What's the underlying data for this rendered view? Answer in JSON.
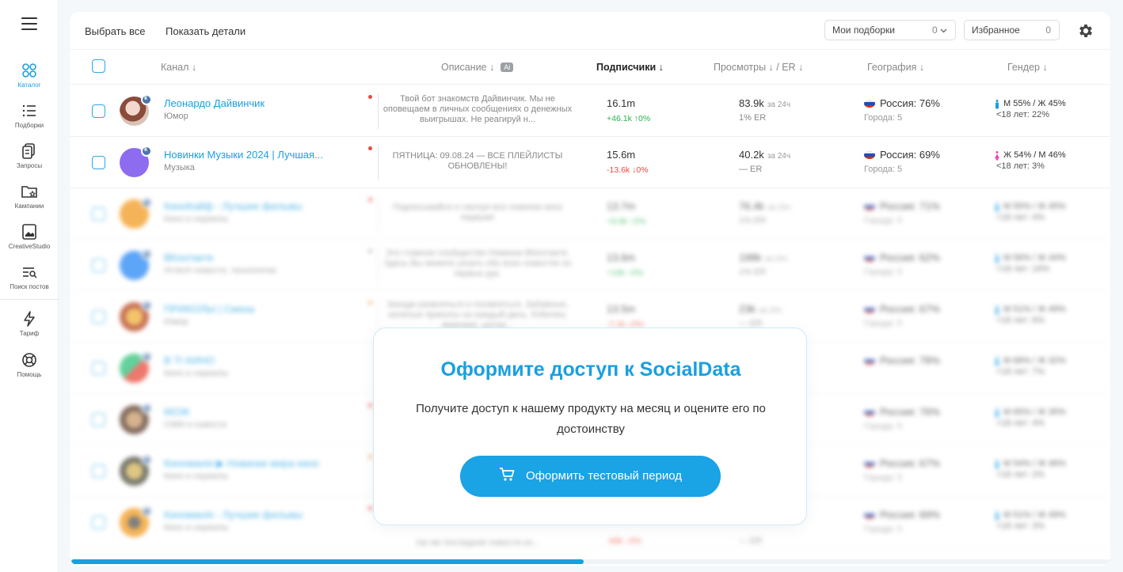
{
  "sidebar": {
    "items": [
      {
        "label": "Каталог",
        "icon": "catalog-icon"
      },
      {
        "label": "Подборки",
        "icon": "list-icon"
      },
      {
        "label": "Запросы",
        "icon": "requests-icon"
      },
      {
        "label": "Кампании",
        "icon": "folder-star-icon"
      },
      {
        "label": "CreativeStudio",
        "icon": "image-icon"
      },
      {
        "label": "Поиск постов",
        "icon": "search-list-icon"
      },
      {
        "label": "Тариф",
        "icon": "lightning-icon"
      },
      {
        "label": "Помощь",
        "icon": "lifebuoy-icon"
      }
    ]
  },
  "toolbar": {
    "select_all": "Выбрать все",
    "show_details": "Показать детали",
    "my_collections": "Мои подборки",
    "my_collections_count": "0",
    "favorites": "Избранное",
    "favorites_count": "0"
  },
  "columns": {
    "channel": "Канал ↓",
    "description": "Описание ↓",
    "ai": "Ai",
    "subscribers": "Подписчики ↓",
    "views": "Просмотры ↓ / ER ↓",
    "geo": "География ↓",
    "gender": "Гендер ↓"
  },
  "rows": [
    {
      "name": "Леонардо Дайвинчик",
      "category": "Юмор",
      "description": "Твой бот знакомств Дайвинчик. Мы не оповещаем в личных сообщениях о денежных выигрышах. Не реагируй н...",
      "subs": "16.1m",
      "growth": "+46.1k ↑0%",
      "views": "83.9k",
      "views_period": "за 24ч",
      "er": "1% ER",
      "geo": "Россия: 76%",
      "cities": "Города: 5",
      "gender": "М 55% / Ж 45%",
      "age": "<18 лет: 22%"
    },
    {
      "name": "Новинки Музыки 2024 | Лучшая...",
      "category": "Музыка",
      "description": "ПЯТНИЦА: 09.08.24 — ВСЕ ПЛЕЙЛИСТЫ ОБНОВЛЕНЫ!",
      "subs": "15.6m",
      "growth": "-13.6k ↓0%",
      "views": "40.2k",
      "views_period": "за 24ч",
      "er": "— ER",
      "geo": "Россия: 69%",
      "cities": "Города: 5",
      "gender": "Ж 54% / М 46%",
      "age": "<18 лет: 3%"
    },
    {
      "name": "КиноКайф - Лучшие фильмы",
      "category": "Кино и сериалы",
      "description": "Подписывайся и смотри все новинки кино первым!",
      "subs": "13.7m",
      "growth": "+8.9k ↑0%",
      "views": "76.4k",
      "views_period": "за 24ч",
      "er": "1% ER",
      "geo": "Россия: 71%",
      "cities": "Города: 5",
      "gender": "М 55% / Ж 45%",
      "age": "<18 лет: 4%"
    },
    {
      "name": "ВКонтакте",
      "category": "Hi-tech новости, технологии",
      "description": "Это главное сообщество Новинки ВКонтакте. Здесь Вы можете узнать обо всех новостях из первых рук.",
      "subs": "13.6m",
      "growth": "+16k ↑0%",
      "views": "198k",
      "views_period": "за 24ч",
      "er": "1% ER",
      "geo": "Россия: 62%",
      "cities": "Города: 5",
      "gender": "М 56% / Ж 44%",
      "age": "<18 лет: 16%"
    },
    {
      "name": "ПРИКОЛЫ | Смеха",
      "category": "Юмор",
      "description": "Заходи развлечься и посмеяться. Забавные, нелепые приколы на каждый день. Юбилеи, мемчики, шутки...",
      "subs": "13.5m",
      "growth": "-7.1k ↓0%",
      "views": "23k",
      "views_period": "за 24ч",
      "er": "— ER",
      "geo": "Россия: 67%",
      "cities": "Города: 5",
      "gender": "М 51% / Ж 49%",
      "age": "<18 лет: 6%"
    },
    {
      "name": "В ТI КИНО",
      "category": "Кино и сериалы",
      "description": "",
      "subs": "",
      "growth": "",
      "views": "",
      "views_period": "",
      "er": "",
      "geo": "Россия: 78%",
      "cities": "",
      "gender": "М 68% / Ж 32%",
      "age": "<18 лет: 7%"
    },
    {
      "name": "МОЖ",
      "category": "СММ и новости",
      "description": "",
      "subs": "",
      "growth": "",
      "views": "",
      "views_period": "",
      "er": "",
      "geo": "Россия: 76%",
      "cities": "Города: 5",
      "gender": "М 65% / Ж 35%",
      "age": "<18 лет: 4%"
    },
    {
      "name": "Киноманія ▶ Новинки мира кино",
      "category": "Кино и сериалы",
      "description": "",
      "subs": "",
      "growth": "",
      "views": "",
      "views_period": "",
      "er": "",
      "geo": "Россия: 67%",
      "cities": "Города: 5",
      "gender": "М 54% / Ж 46%",
      "age": "<18 лет: 2%"
    },
    {
      "name": "Киноманія - Лучшие фильмы",
      "category": "Кино и сериалы",
      "description": "так же последние новости из...",
      "subs": "",
      "growth": "-96k ↓0%",
      "views": "",
      "views_period": "",
      "er": "— ER",
      "geo": "Россия: 69%",
      "cities": "Города: 5",
      "gender": "М 51% / Ж 49%",
      "age": "<18 лет: 3%"
    }
  ],
  "modal": {
    "title": "Оформите доступ к SocialData",
    "text": "Получите доступ к нашему продукту на месяц и оцените его по достоинству",
    "button": "Оформить тестовый период"
  },
  "colors": {
    "accent": "#1a9fe0",
    "up": "#27b24b",
    "down": "#e84b3c"
  }
}
